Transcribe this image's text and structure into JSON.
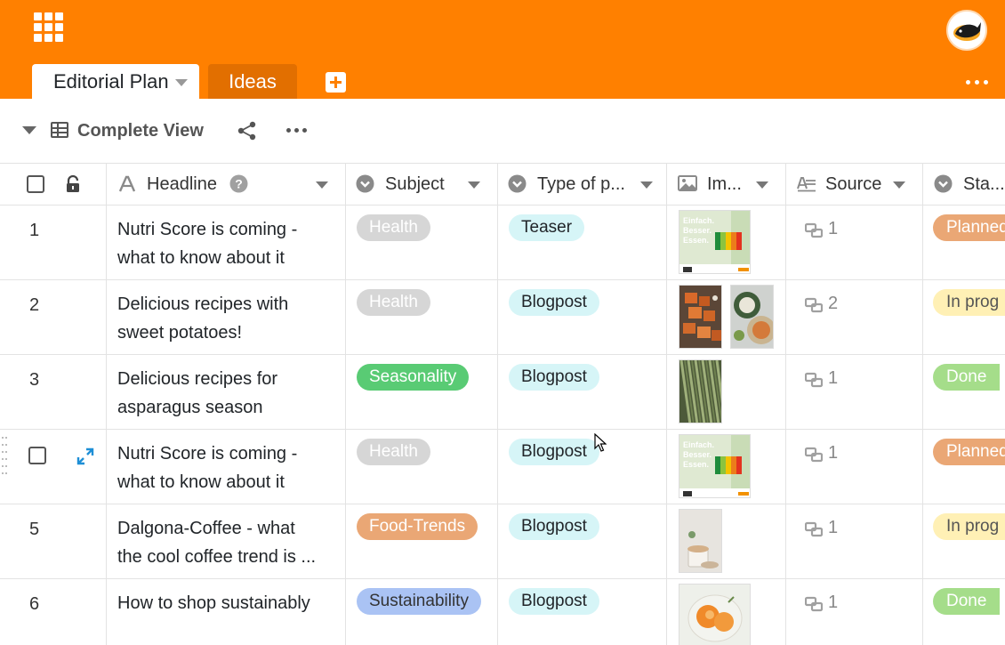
{
  "app": {
    "tabs": [
      {
        "label": "Editorial Plan",
        "active": true
      },
      {
        "label": "Ideas",
        "active": false
      }
    ],
    "accent_color": "#ff8000"
  },
  "view": {
    "name": "Complete View"
  },
  "columns": [
    {
      "name": "Headline",
      "icon": "text-icon"
    },
    {
      "name": "Subject",
      "icon": "single-select-icon"
    },
    {
      "name": "Type of p...",
      "icon": "single-select-icon"
    },
    {
      "name": "Im...",
      "icon": "image-icon"
    },
    {
      "name": "Source",
      "icon": "link-icon"
    },
    {
      "name": "Sta...",
      "icon": "single-select-icon"
    }
  ],
  "rows": [
    {
      "num": "1",
      "headline": [
        "Nutri Score is coming -",
        "what to know about it"
      ],
      "subject": "Health",
      "type": "Teaser",
      "images": 1,
      "image_kind": "nutri",
      "source": "1",
      "status": "Planned"
    },
    {
      "num": "2",
      "headline": [
        "Delicious recipes with",
        "sweet potatoes!"
      ],
      "subject": "Health",
      "type": "Blogpost",
      "images": 2,
      "image_kind": "potato",
      "source": "2",
      "status": "In prog"
    },
    {
      "num": "3",
      "headline": [
        "Delicious recipes for",
        "asparagus season"
      ],
      "subject": "Seasonality",
      "type": "Blogpost",
      "images": 1,
      "image_kind": "asparagus",
      "source": "1",
      "status": "Done"
    },
    {
      "num": "",
      "headline": [
        "Nutri Score is coming -",
        "what to know about it"
      ],
      "subject": "Health",
      "type": "Blogpost",
      "images": 1,
      "image_kind": "nutri",
      "source": "1",
      "status": "Planned"
    },
    {
      "num": "5",
      "headline": [
        "Dalgona-Coffee - what",
        "the cool coffee trend is ..."
      ],
      "subject": "Food-Trends",
      "type": "Blogpost",
      "images": 1,
      "image_kind": "coffee",
      "source": "1",
      "status": "In prog"
    },
    {
      "num": "6",
      "headline": [
        "How to shop sustainably",
        ""
      ],
      "subject": "Sustainability",
      "type": "Blogpost",
      "images": 1,
      "image_kind": "orange",
      "source": "1",
      "status": "Done"
    }
  ],
  "subject_colors": {
    "Health": "#d6d6d6",
    "Seasonality": "#59cb74",
    "Food-Trends": "#eaa775",
    "Sustainability": "#aac3f4"
  },
  "status_colors": {
    "Planned": "#eaa775",
    "In prog": "#fff0b5",
    "Done": "#a5dd8a"
  },
  "type_color": "#d6f5f7",
  "nutri_image_text": [
    "Einfach.",
    "Besser.",
    "Essen."
  ]
}
